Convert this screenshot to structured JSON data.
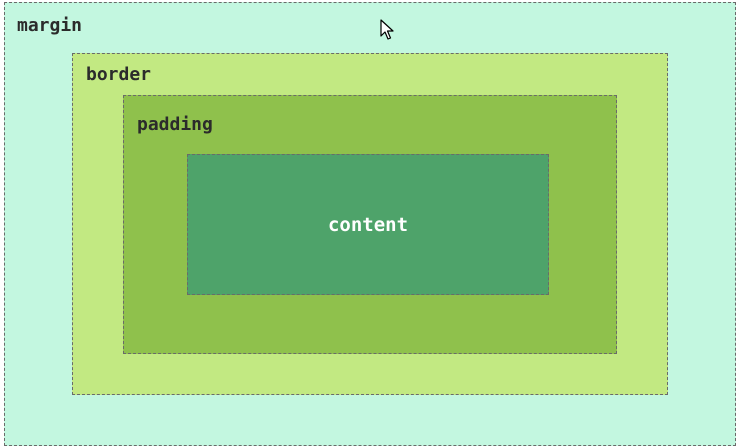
{
  "box_model": {
    "margin": {
      "label": "margin",
      "color": "#c3f7e0"
    },
    "border": {
      "label": "border",
      "color": "#c2e982"
    },
    "padding": {
      "label": "padding",
      "color": "#8fc14c"
    },
    "content": {
      "label": "content",
      "color": "#4ea36a"
    }
  },
  "cursor": {
    "icon": "arrow-cursor-icon"
  }
}
